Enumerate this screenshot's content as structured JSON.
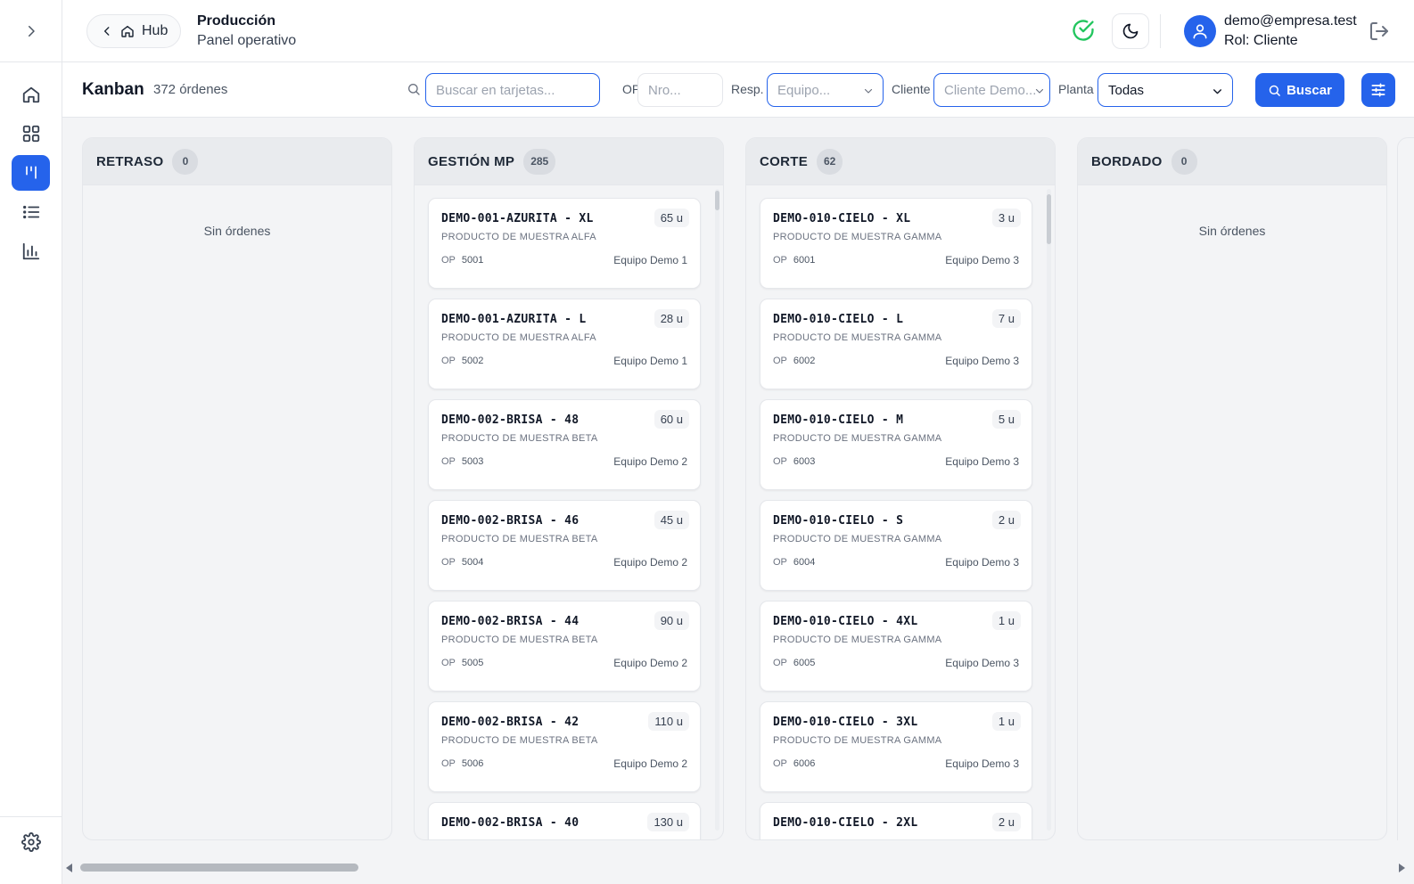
{
  "sidebar": {
    "toggle_icon": "chevron-right-icon",
    "items": [
      {
        "name": "home",
        "icon": "home-icon",
        "active": false
      },
      {
        "name": "dashboard",
        "icon": "grid-icon",
        "active": false
      },
      {
        "name": "kanban",
        "icon": "kanban-icon",
        "active": true
      },
      {
        "name": "list",
        "icon": "list-icon",
        "active": false
      },
      {
        "name": "reports",
        "icon": "bar-chart-icon",
        "active": false
      }
    ],
    "settings_icon": "gear-icon"
  },
  "header": {
    "hub_label": "Hub",
    "title": "Producción",
    "subtitle": "Panel operativo",
    "user_email": "demo@empresa.test",
    "user_role": "Rol: Cliente"
  },
  "toolbar": {
    "title": "Kanban",
    "count": "372 órdenes",
    "search_placeholder": "Buscar en tarjetas...",
    "op_label": "OP",
    "op_placeholder": "Nro...",
    "resp_label": "Resp.",
    "resp_placeholder": "Equipo...",
    "cliente_label": "Cliente",
    "cliente_placeholder": "Cliente Demo...",
    "planta_label": "Planta",
    "planta_value": "Todas",
    "buscar_label": "Buscar"
  },
  "columns": [
    {
      "title": "RETRASO",
      "count": "0",
      "empty_text": "Sin órdenes",
      "cards": []
    },
    {
      "title": "GESTIÓN MP",
      "count": "285",
      "cards": [
        {
          "code": "DEMO-001-AZURITA - XL",
          "qty": "65 u",
          "product": "PRODUCTO DE MUESTRA ALFA",
          "op_label": "OP",
          "op": "5001",
          "team": "Equipo Demo 1"
        },
        {
          "code": "DEMO-001-AZURITA - L",
          "qty": "28 u",
          "product": "PRODUCTO DE MUESTRA ALFA",
          "op_label": "OP",
          "op": "5002",
          "team": "Equipo Demo 1"
        },
        {
          "code": "DEMO-002-BRISA - 48",
          "qty": "60 u",
          "product": "PRODUCTO DE MUESTRA BETA",
          "op_label": "OP",
          "op": "5003",
          "team": "Equipo Demo 2"
        },
        {
          "code": "DEMO-002-BRISA - 46",
          "qty": "45 u",
          "product": "PRODUCTO DE MUESTRA BETA",
          "op_label": "OP",
          "op": "5004",
          "team": "Equipo Demo 2"
        },
        {
          "code": "DEMO-002-BRISA - 44",
          "qty": "90 u",
          "product": "PRODUCTO DE MUESTRA BETA",
          "op_label": "OP",
          "op": "5005",
          "team": "Equipo Demo 2"
        },
        {
          "code": "DEMO-002-BRISA - 42",
          "qty": "110 u",
          "product": "PRODUCTO DE MUESTRA BETA",
          "op_label": "OP",
          "op": "5006",
          "team": "Equipo Demo 2"
        },
        {
          "code": "DEMO-002-BRISA - 40",
          "qty": "130 u",
          "product": "",
          "op_label": "",
          "op": "",
          "team": ""
        }
      ]
    },
    {
      "title": "CORTE",
      "count": "62",
      "cards": [
        {
          "code": "DEMO-010-CIELO - XL",
          "qty": "3 u",
          "product": "PRODUCTO DE MUESTRA GAMMA",
          "op_label": "OP",
          "op": "6001",
          "team": "Equipo Demo 3"
        },
        {
          "code": "DEMO-010-CIELO - L",
          "qty": "7 u",
          "product": "PRODUCTO DE MUESTRA GAMMA",
          "op_label": "OP",
          "op": "6002",
          "team": "Equipo Demo 3"
        },
        {
          "code": "DEMO-010-CIELO - M",
          "qty": "5 u",
          "product": "PRODUCTO DE MUESTRA GAMMA",
          "op_label": "OP",
          "op": "6003",
          "team": "Equipo Demo 3"
        },
        {
          "code": "DEMO-010-CIELO - S",
          "qty": "2 u",
          "product": "PRODUCTO DE MUESTRA GAMMA",
          "op_label": "OP",
          "op": "6004",
          "team": "Equipo Demo 3"
        },
        {
          "code": "DEMO-010-CIELO - 4XL",
          "qty": "1 u",
          "product": "PRODUCTO DE MUESTRA GAMMA",
          "op_label": "OP",
          "op": "6005",
          "team": "Equipo Demo 3"
        },
        {
          "code": "DEMO-010-CIELO - 3XL",
          "qty": "1 u",
          "product": "PRODUCTO DE MUESTRA GAMMA",
          "op_label": "OP",
          "op": "6006",
          "team": "Equipo Demo 3"
        },
        {
          "code": "DEMO-010-CIELO - 2XL",
          "qty": "2 u",
          "product": "",
          "op_label": "",
          "op": "",
          "team": ""
        }
      ]
    },
    {
      "title": "BORDADO",
      "count": "0",
      "empty_text": "Sin órdenes",
      "cards": []
    }
  ],
  "colors": {
    "accent": "#2563eb",
    "success": "#22c55e",
    "background": "#f3f4f6"
  }
}
